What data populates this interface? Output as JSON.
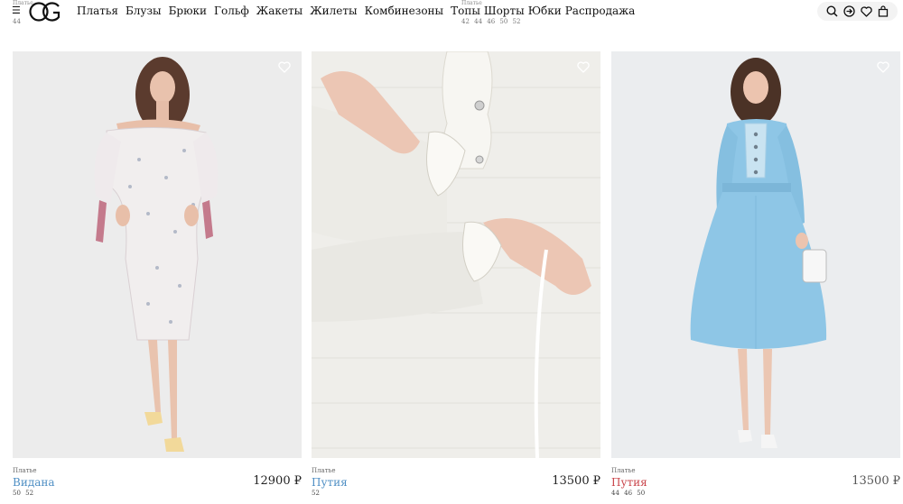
{
  "header": {
    "menu_icon": "☰",
    "logo_icon": "og-monogram-logo",
    "nav": [
      "Платья",
      "Блузы",
      "Брюки",
      "Гольф",
      "Жакеты",
      "Жилеты",
      "Комбинезоны",
      "Топы",
      "Шорты",
      "Юбки",
      "Распродажа"
    ],
    "icons": [
      "search-icon",
      "login-icon",
      "heart-icon",
      "bag-icon"
    ]
  },
  "previous_row": [
    {
      "category": "Платье",
      "sizes": "44"
    },
    {
      "category": "Платье",
      "sizes": "42 44 46 50 52"
    }
  ],
  "products": [
    {
      "category": "Платье",
      "name": "Видана",
      "price": "12900 ₽",
      "sizes": "50 52",
      "on_sale": false
    },
    {
      "category": "Платье",
      "name": "Путия",
      "price": "13500 ₽",
      "sizes": "52",
      "on_sale": false
    },
    {
      "category": "Платье",
      "name": "Путия",
      "price": "13500 ₽",
      "sizes": "44 46 50",
      "on_sale": true
    }
  ],
  "colors": {
    "name_link": "#4f8fc4",
    "sale_name": "#c9444a",
    "photo_bg": "#ededed",
    "dress_blue": "#8ec6e6"
  }
}
